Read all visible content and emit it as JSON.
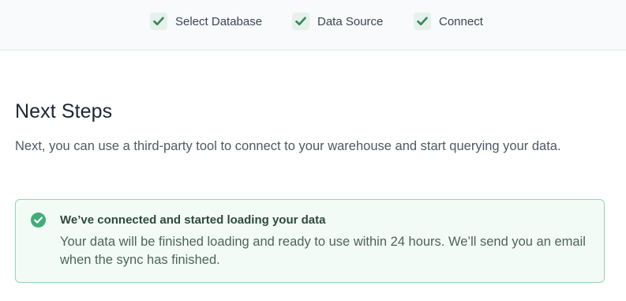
{
  "stepper": {
    "steps": [
      {
        "label": "Select Database",
        "status": "complete"
      },
      {
        "label": "Data Source",
        "status": "complete"
      },
      {
        "label": "Connect",
        "status": "complete"
      }
    ],
    "check_icon": "check-icon",
    "check_color": "#2f8a58"
  },
  "main": {
    "title": "Next Steps",
    "subtitle": "Next, you can use a third-party tool to connect to your warehouse and start querying your data."
  },
  "callout": {
    "icon": "check-circle-icon",
    "title": "We’ve connected and started loading your data",
    "body": "Your data will be finished loading and ready to use within 24 hours. We’ll send you an email when the sync has finished.",
    "accent_color": "#3fae77",
    "border_color": "#95d4b2",
    "background_color": "#f3fbf7"
  }
}
